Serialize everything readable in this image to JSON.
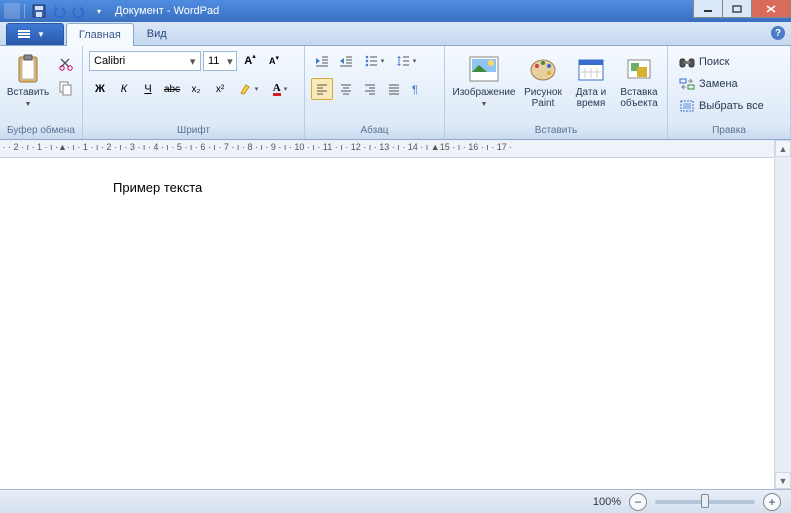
{
  "window": {
    "title": "Документ - WordPad"
  },
  "tabs": {
    "home": "Главная",
    "view": "Вид"
  },
  "clipboard": {
    "paste": "Вставить",
    "group": "Буфер обмена"
  },
  "font": {
    "name": "Calibri",
    "size": "11",
    "group": "Шрифт",
    "bold": "Ж",
    "italic": "К",
    "underline": "Ч",
    "strike": "abc",
    "sub": "x₂",
    "sup": "x²"
  },
  "paragraph": {
    "group": "Абзац"
  },
  "insert": {
    "image": "Изображение",
    "paint": "Рисунок\nPaint",
    "datetime": "Дата и\nвремя",
    "object": "Вставка\nобъекта",
    "group": "Вставить"
  },
  "edit": {
    "find": "Поиск",
    "replace": "Замена",
    "selectall": "Выбрать все",
    "group": "Правка"
  },
  "ruler": " · · 2 · ı · 1 · ı ·▲· ı · 1 · ı · 2 · ı · 3 · ı · 4 · ı · 5 · ı · 6 · ı · 7 · ı · 8 · ı · 9 · ı · 10 · ı · 11 · ı · 12 · ı · 13 · ı · 14 · ı ▲15 · ı · 16 · ı · 17 ·",
  "document": {
    "text": "Пример текста"
  },
  "status": {
    "zoom": "100%"
  }
}
